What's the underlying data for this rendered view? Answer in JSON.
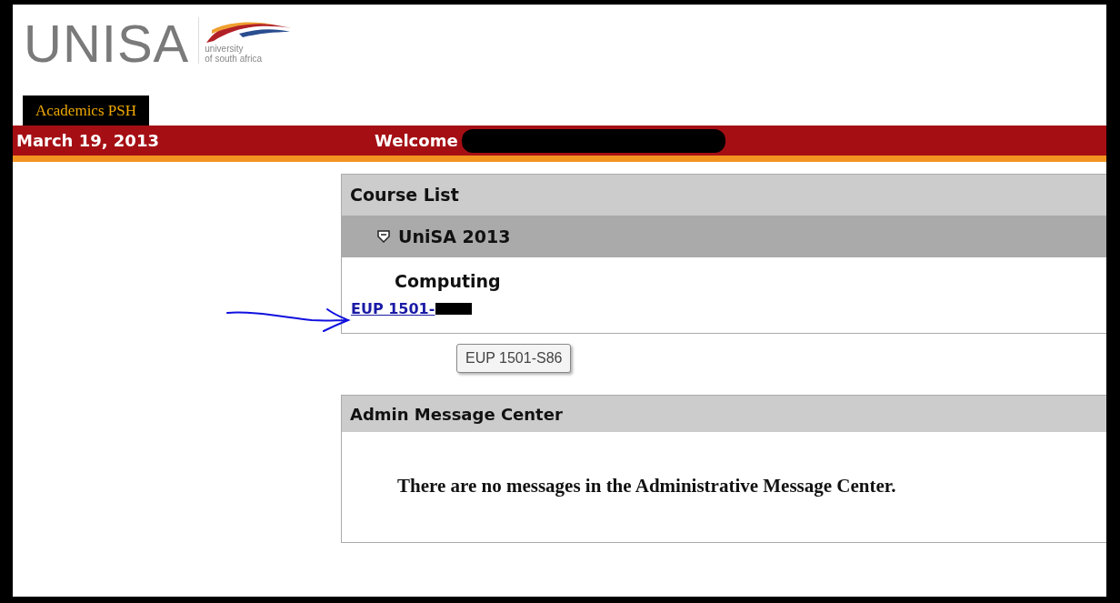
{
  "logo": {
    "wordmark": "UNISA",
    "tagline_1": "university",
    "tagline_2": "of south africa"
  },
  "tabs": [
    {
      "label": "Academics PSH",
      "selected": true
    }
  ],
  "banner": {
    "date": "March 19, 2013",
    "welcome": "Welcome"
  },
  "course_list": {
    "title": "Course List",
    "group": {
      "label": "UniSA 2013",
      "expanded": true
    },
    "category": "Computing",
    "course_link": "EUP 1501-",
    "tooltip": "EUP 1501-S86"
  },
  "message_center": {
    "title": "Admin Message Center",
    "message": "There are no messages in the Administrative Message Center."
  }
}
